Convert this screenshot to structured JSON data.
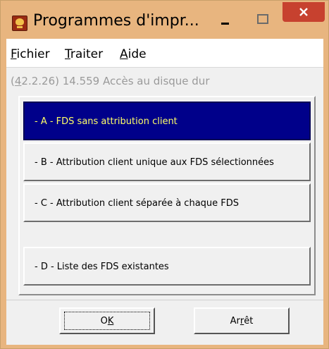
{
  "window": {
    "title": "Programmes d'impr...",
    "icon": "skull-crossbones-icon"
  },
  "menu": {
    "items": [
      {
        "accel": "F",
        "rest": "ichier"
      },
      {
        "accel": "T",
        "rest": "raiter"
      },
      {
        "accel": "A",
        "rest": "ide"
      }
    ]
  },
  "status": {
    "ref_prefix": "(",
    "ref_accel": "4",
    "ref_rest": "2.2.26) 14.559 Accès au disque dur"
  },
  "options": [
    {
      "label": "- A -   FDS sans attribution client",
      "selected": true
    },
    {
      "label": "- B -   Attribution client unique aux FDS sélectionnées",
      "selected": false
    },
    {
      "label": "- C -   Attribution client séparée à chaque FDS",
      "selected": false
    },
    {
      "label": "- D -   Liste des FDS existantes",
      "selected": false
    }
  ],
  "buttons": {
    "ok_accel_pre": "O",
    "ok_accel": "K",
    "stop_pre": "Ar",
    "stop_accel": "r",
    "stop_rest": "êt"
  },
  "colors": {
    "title_bg": "#e8b57f",
    "close_red": "#c7412f",
    "selected_bg": "#00008a",
    "selected_text": "#ffff66"
  }
}
